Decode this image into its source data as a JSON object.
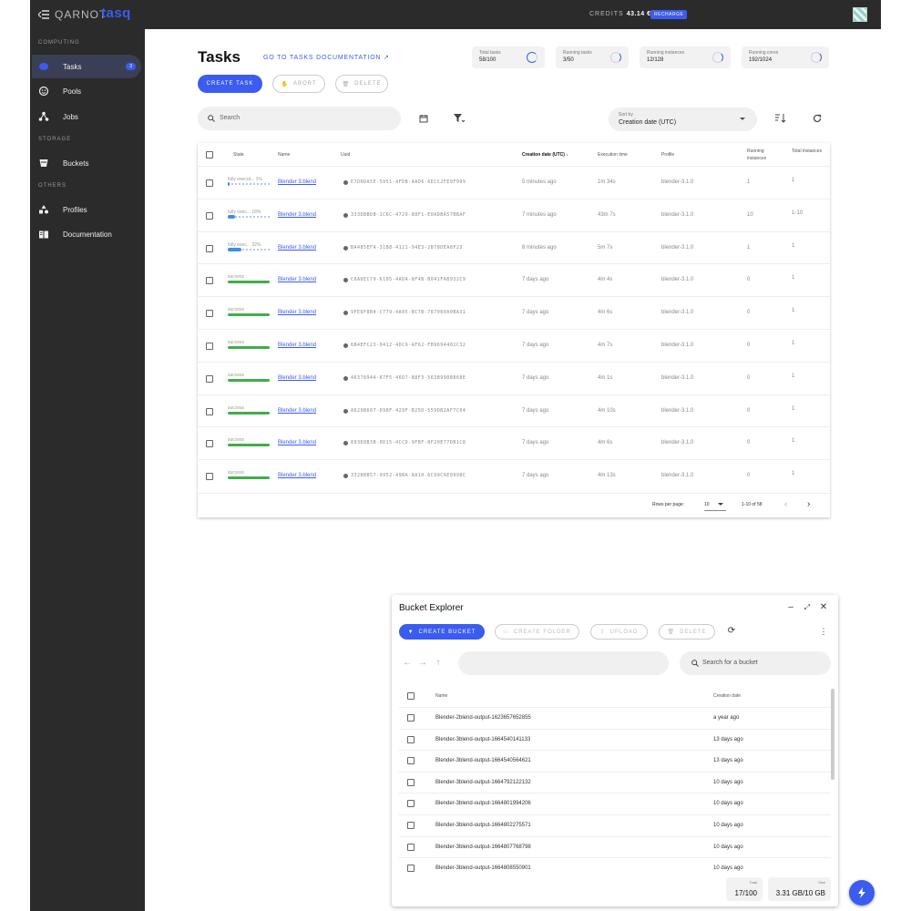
{
  "topbar": {
    "brand": "QARNOT",
    "product": "tasq",
    "credits_label": "CREDITS",
    "credits_value": "43.14 €",
    "recharge_label": "RECHARGE"
  },
  "sidebar": {
    "section_computing": "COMPUTING",
    "section_storage": "STORAGE",
    "section_others": "OTHERS",
    "items": [
      {
        "label": "Tasks",
        "count": "3",
        "icon": "tasks-icon"
      },
      {
        "label": "Pools",
        "icon": "pools-icon"
      },
      {
        "label": "Jobs",
        "icon": "jobs-icon"
      },
      {
        "label": "Buckets",
        "icon": "bucket-icon"
      },
      {
        "label": "Profiles",
        "icon": "profiles-icon"
      },
      {
        "label": "Documentation",
        "icon": "book-icon"
      }
    ]
  },
  "header": {
    "title": "Tasks",
    "doc_link": "GO TO TASKS DOCUMENTATION",
    "stats": [
      {
        "label": "Total tasks",
        "value": "58/100"
      },
      {
        "label": "Running tasks",
        "value": "3/50"
      },
      {
        "label": "Running instances",
        "value": "12/128"
      },
      {
        "label": "Running cores",
        "value": "192/1024"
      }
    ]
  },
  "toolbar": {
    "create_label": "CREATE TASK",
    "abort_label": "ABORT",
    "delete_label": "DELETE",
    "search_placeholder": "Search",
    "sort_label": "Sort by",
    "sort_value": "Creation date (UTC)"
  },
  "table": {
    "columns": [
      "State",
      "Name",
      "Uuid",
      "Creation date (UTC)",
      "Execution time",
      "Profile",
      "Running instances",
      "Total instances"
    ],
    "rows": [
      {
        "state": "fully execut...",
        "progress_text": "1%",
        "progress": 0.01,
        "kind": "running",
        "name": "Blender 3.blend",
        "uuid": "E7D0DA5E-5951-4FDB-AAD6-6ECC2FE9F999",
        "created": "5 minutes ago",
        "exec": "1m 34s",
        "profile": "blender-3.1.0",
        "running": "1",
        "total": "1"
      },
      {
        "state": "fully exec...",
        "progress_text": "18%",
        "progress": 0.18,
        "kind": "running",
        "name": "Blender 3.blend",
        "uuid": "333DBBDB-1C6C-4729-88F1-E0ADBA57BBAF",
        "created": "7 minutes ago",
        "exec": "43m 7s",
        "profile": "blender-3.1.0",
        "running": "10",
        "total": "1-10"
      },
      {
        "state": "fully exec...",
        "progress_text": "32%",
        "progress": 0.32,
        "kind": "running",
        "name": "Blender 3.blend",
        "uuid": "BA485EFA-31B8-4121-94E3-2B78DEA8F23",
        "created": "8 minutes ago",
        "exec": "5m 7s",
        "profile": "blender-3.1.0",
        "running": "1",
        "total": "1"
      },
      {
        "state": "success",
        "progress_text": "",
        "progress": 1,
        "kind": "success",
        "name": "Blender 3.blend",
        "uuid": "C0A6EC79-6105-4ADA-8F4B-B041FAB932C9",
        "created": "7 days ago",
        "exec": "4m 4s",
        "profile": "blender-3.1.0",
        "running": "0",
        "total": "1"
      },
      {
        "state": "success",
        "progress_text": "",
        "progress": 1,
        "kind": "success",
        "name": "Blender 3.blend",
        "uuid": "9FE6F8B4-C779-4A05-BC7B-787000A0BA31",
        "created": "7 days ago",
        "exec": "4m 6s",
        "profile": "blender-3.1.0",
        "running": "0",
        "total": "1"
      },
      {
        "state": "success",
        "progress_text": "",
        "progress": 1,
        "kind": "success",
        "name": "Blender 3.blend",
        "uuid": "6B4EFC23-0412-4DC9-AF62-FB9694402C32",
        "created": "7 days ago",
        "exec": "4m 7s",
        "profile": "blender-3.1.0",
        "running": "0",
        "total": "1"
      },
      {
        "state": "success",
        "progress_text": "",
        "progress": 1,
        "kind": "success",
        "name": "Blender 3.blend",
        "uuid": "46378944-87F5-46D7-B8F3-563B990B868E",
        "created": "7 days ago",
        "exec": "4m 1s",
        "profile": "blender-3.1.0",
        "running": "0",
        "total": "1"
      },
      {
        "state": "success",
        "progress_text": "",
        "progress": 1,
        "kind": "success",
        "name": "Blender 3.blend",
        "uuid": "A629B607-D98F-429F-B25D-559DB2AF7C04",
        "created": "7 days ago",
        "exec": "4m 10s",
        "profile": "blender-3.1.0",
        "running": "0",
        "total": "1"
      },
      {
        "state": "success",
        "progress_text": "",
        "progress": 1,
        "kind": "success",
        "name": "Blender 3.blend",
        "uuid": "893D8B3B-0D15-4CCD-9FBF-8F20E77DB1C8",
        "created": "7 days ago",
        "exec": "4m 6s",
        "profile": "blender-3.1.0",
        "running": "0",
        "total": "1"
      },
      {
        "state": "success",
        "progress_text": "",
        "progress": 1,
        "kind": "success",
        "name": "Blender 3.blend",
        "uuid": "3328BB57-9952-49BA-8A10-6C99CAE0998C",
        "created": "7 days ago",
        "exec": "4m 13s",
        "profile": "blender-3.1.0",
        "running": "0",
        "total": "1"
      }
    ],
    "rows_per_page_label": "Rows per page:",
    "rows_per_page_value": "10",
    "range": "1-10 of 58"
  },
  "bucket": {
    "title": "Bucket Explorer",
    "create_label": "CREATE BUCKET",
    "folder_label": "CREATE FOLDER",
    "upload_label": "UPLOAD",
    "delete_label": "DELETE",
    "search_placeholder": "Search for a bucket",
    "col_name": "Name",
    "col_date": "Creation date",
    "rows": [
      {
        "name": "Blender-2blend-output-1623657652855",
        "date": "a year ago"
      },
      {
        "name": "Blender-3blend-output-1664540141133",
        "date": "13 days ago"
      },
      {
        "name": "Blender-3blend-output-1664540564621",
        "date": "13 days ago"
      },
      {
        "name": "Blender-3blend-output-1664792122132",
        "date": "10 days ago"
      },
      {
        "name": "Blender-3blend-output-1664801994206",
        "date": "10 days ago"
      },
      {
        "name": "Blender-3blend-output-1664802275571",
        "date": "10 days ago"
      },
      {
        "name": "Blender-3blend-output-1664807768798",
        "date": "10 days ago"
      },
      {
        "name": "Blender-3blend-output-1664808550901",
        "date": "10 days ago"
      }
    ],
    "total_label": "Total",
    "total_value": "17/100",
    "size_label": "Size",
    "size_value": "3.31 GB/10 GB"
  },
  "colors": {
    "accent": "#3b5cf0",
    "success": "#3fae49",
    "sidebar": "#2b2b2b"
  }
}
